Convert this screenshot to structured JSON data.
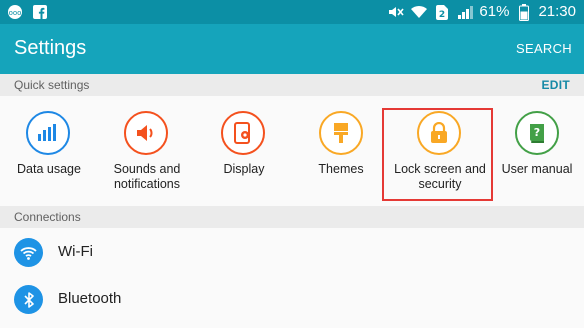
{
  "status_bar": {
    "battery": "61%",
    "time": "21:30"
  },
  "app_bar": {
    "title": "Settings",
    "search_label": "SEARCH"
  },
  "quick_settings": {
    "header": "Quick settings",
    "edit_label": "EDIT",
    "items": [
      {
        "label": "Data usage",
        "icon": "data-usage-icon",
        "color": "#1e88e5"
      },
      {
        "label": "Sounds and notifications",
        "icon": "speaker-icon",
        "color": "#f4511e"
      },
      {
        "label": "Display",
        "icon": "display-icon",
        "color": "#f4511e"
      },
      {
        "label": "Themes",
        "icon": "brush-icon",
        "color": "#f9a825"
      },
      {
        "label": "Lock screen and security",
        "icon": "lock-icon",
        "color": "#f9a825"
      },
      {
        "label": "User manual",
        "icon": "book-icon",
        "color": "#43a047"
      }
    ]
  },
  "connections": {
    "header": "Connections",
    "items": [
      {
        "label": "Wi-Fi",
        "icon": "wifi-icon"
      },
      {
        "label": "Bluetooth",
        "icon": "bluetooth-icon"
      }
    ]
  },
  "colors": {
    "status_bar": "#0c8fa5",
    "app_bar": "#15a4bb",
    "accent": "#1589a6",
    "highlight": "#e53935"
  }
}
